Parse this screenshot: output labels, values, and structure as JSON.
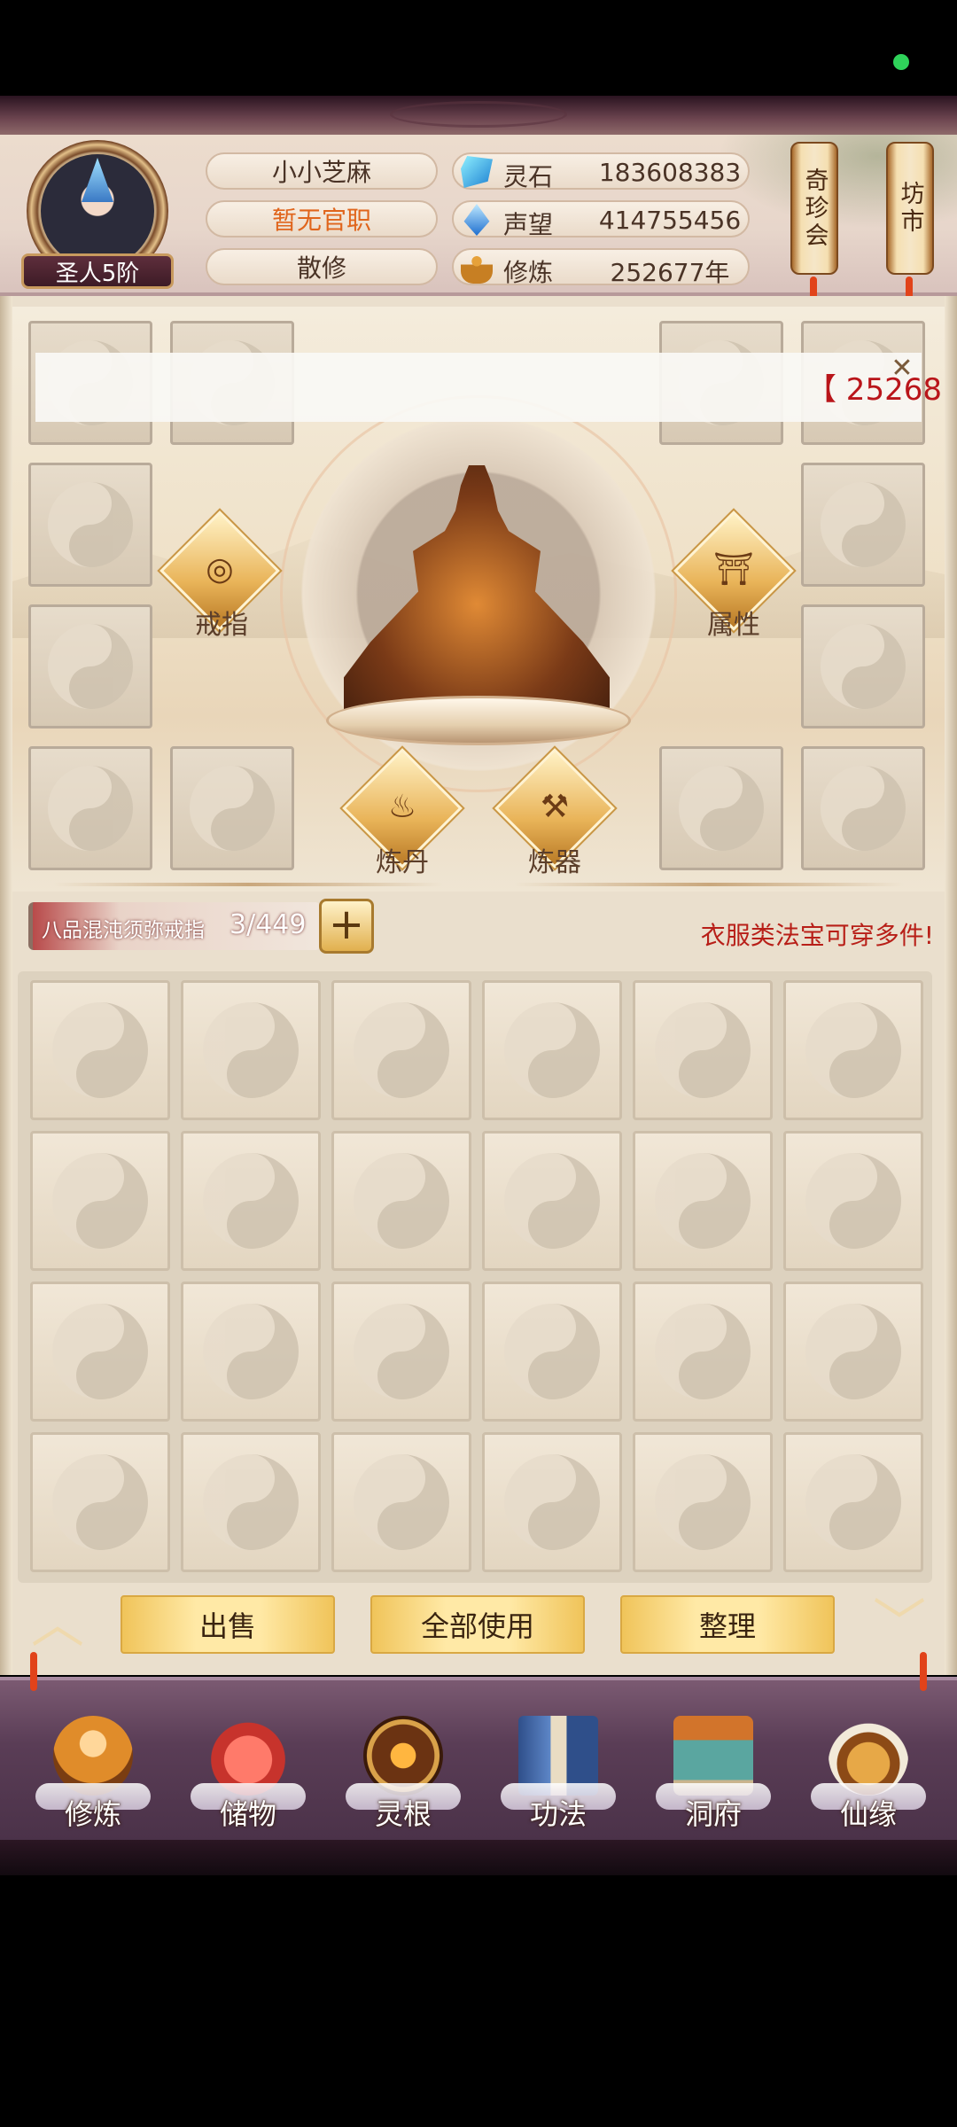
{
  "header": {
    "rank": "圣人5阶",
    "player_name": "小小芝麻",
    "official_title": "暂无官职",
    "sect": "散修",
    "resources": [
      {
        "icon": "spirit-stone-icon",
        "label": "灵石",
        "value": "183608383"
      },
      {
        "icon": "prestige-icon",
        "label": "声望",
        "value": "414755456"
      },
      {
        "icon": "cultivation-icon",
        "label": "修炼",
        "value": "252677年"
      }
    ],
    "shops": [
      {
        "label": "奇珍会"
      },
      {
        "label": "坊市"
      }
    ]
  },
  "equipment": {
    "overlay_value": "【 25268",
    "ring_label": "戒指",
    "attr_label": "属性",
    "alchemy_label": "炼丹",
    "forge_label": "炼器"
  },
  "storage": {
    "ring_name": "八品混沌须弥戒指",
    "capacity": "3/449",
    "tip": "衣服类法宝可穿多件!"
  },
  "actions": {
    "sell": "出售",
    "use_all": "全部使用",
    "sort": "整理"
  },
  "nav": [
    {
      "label": "修炼",
      "icon": "cultivation-nav-icon"
    },
    {
      "label": "储物",
      "icon": "storage-bag-icon"
    },
    {
      "label": "灵根",
      "icon": "spirit-root-icon"
    },
    {
      "label": "功法",
      "icon": "technique-book-icon"
    },
    {
      "label": "洞府",
      "icon": "cave-abode-icon"
    },
    {
      "label": "仙缘",
      "icon": "immortal-fate-icon"
    }
  ],
  "colors": {
    "accent_gold": "#f0c45a",
    "tip_red": "#b81f18",
    "nav_purple": "#5a3d56"
  }
}
